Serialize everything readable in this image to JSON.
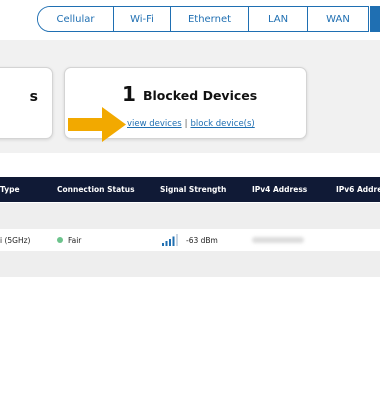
{
  "tabs": [
    {
      "label": "Cellular"
    },
    {
      "label": "Wi-Fi"
    },
    {
      "label": "Ethernet"
    },
    {
      "label": "LAN"
    },
    {
      "label": "WAN"
    }
  ],
  "summary": {
    "left_card_text": "s",
    "blocked_count": "1",
    "blocked_title": "Blocked Devices",
    "view_devices_link": "view devices",
    "separator": "|",
    "block_devices_link": "block device(s)"
  },
  "table": {
    "headers": [
      "Type",
      "Connection Status",
      "Signal Strength",
      "IPv4 Address",
      "IPv6 Addre"
    ],
    "row": {
      "type": "i (5GHz)",
      "status": "Fair",
      "signal": "-63 dBm"
    }
  },
  "colors": {
    "accent": "#1f6fb2",
    "header_bg": "#101a36",
    "arrow": "#f2a900",
    "status_fair": "#6cc38c"
  }
}
